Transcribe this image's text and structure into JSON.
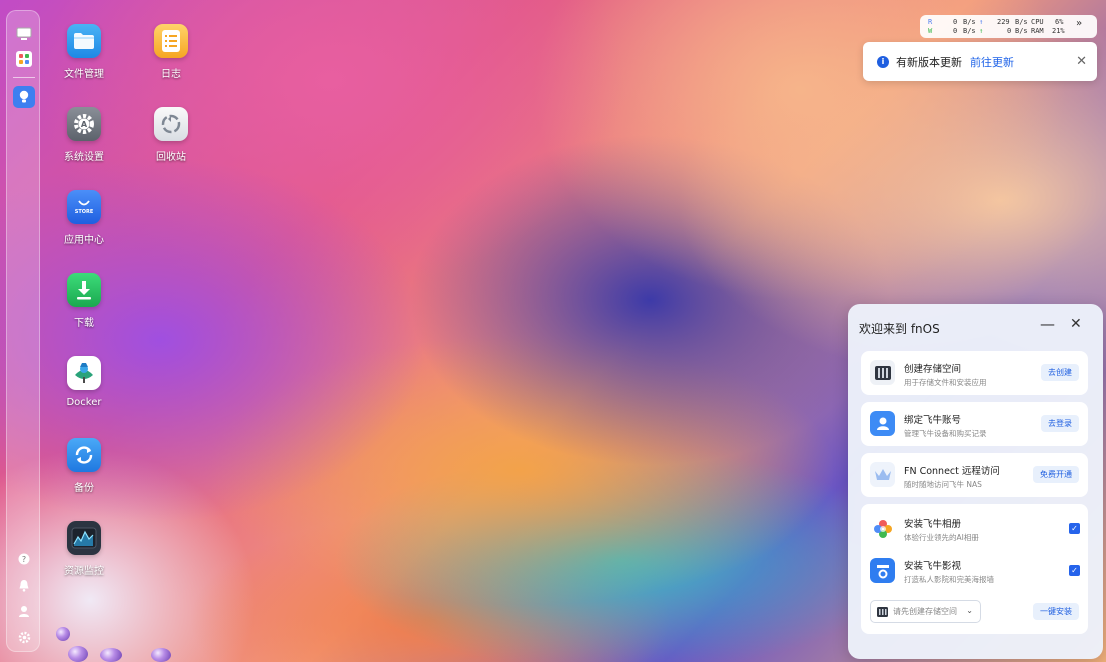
{
  "desktop": {
    "icons": [
      {
        "label": "文件管理",
        "icon": "folder-icon"
      },
      {
        "label": "日志",
        "icon": "log-icon"
      },
      {
        "label": "系统设置",
        "icon": "gear-icon"
      },
      {
        "label": "回收站",
        "icon": "recycle-bin-icon"
      },
      {
        "label": "应用中心",
        "icon": "store-icon",
        "badge": "STORE"
      },
      {
        "label": "下载",
        "icon": "download-icon"
      },
      {
        "label": "Docker",
        "icon": "docker-icon"
      },
      {
        "label": "备份",
        "icon": "backup-icon"
      },
      {
        "label": "资源监控",
        "icon": "resource-monitor-icon"
      }
    ]
  },
  "sidebar": {
    "top": [
      "monitor-icon",
      "apps-grid-icon",
      "lightbulb-icon"
    ],
    "bottom": [
      "help-icon",
      "bell-icon",
      "user-icon",
      "settings-icon"
    ]
  },
  "monitor": {
    "r_label": "R",
    "w_label": "W",
    "r_down": "0",
    "r_down_unit": "B/s",
    "r_up": "229",
    "r_up_unit": "B/s",
    "w_down": "0",
    "w_down_unit": "B/s",
    "w_up": "0",
    "w_up_unit": "B/s",
    "cpu_label": "CPU",
    "cpu_value": "6%",
    "ram_label": "RAM",
    "ram_value": "21%"
  },
  "toast": {
    "message": "有新版本更新",
    "link": "前往更新"
  },
  "welcome": {
    "title": "欢迎来到 fnOS",
    "items": [
      {
        "title": "创建存储空间",
        "subtitle": "用于存储文件和安装应用",
        "button": "去创建"
      },
      {
        "title": "绑定飞牛账号",
        "subtitle": "管理飞牛设备和购买记录",
        "button": "去登录"
      },
      {
        "title": "FN Connect 远程访问",
        "subtitle": "随时随地访问飞牛 NAS",
        "button": "免费开通"
      }
    ],
    "installs": [
      {
        "title": "安装飞牛相册",
        "subtitle": "体验行业领先的AI相册",
        "checked": true
      },
      {
        "title": "安装飞牛影视",
        "subtitle": "打造私人影院和完美海报墙",
        "checked": true
      }
    ],
    "storage_select_placeholder": "请先创建存储空间",
    "install_button": "一键安装"
  },
  "colors": {
    "accent": "#1f5fe0"
  }
}
